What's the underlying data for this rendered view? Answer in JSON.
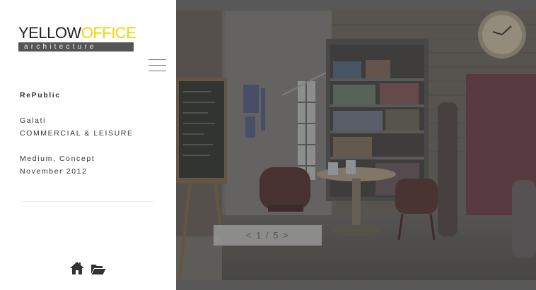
{
  "logo": {
    "word_part1": "YELLOW",
    "word_part2": "OFFICE",
    "tagline": "architecture",
    "colors": {
      "dark": "#222222",
      "yellow": "#f2d500",
      "bar": "#555555"
    }
  },
  "project": {
    "name": "RePublic",
    "location": "Galati",
    "category": "COMMERCIAL & LEISURE",
    "details": "Medium, Concept",
    "date": "November 2012"
  },
  "icons": {
    "menu": "hamburger-menu-icon",
    "home": "home-icon",
    "folder": "open-folder-icon"
  },
  "gallery": {
    "pager_label": "< 1 / 5 >",
    "current": 1,
    "total": 5
  }
}
